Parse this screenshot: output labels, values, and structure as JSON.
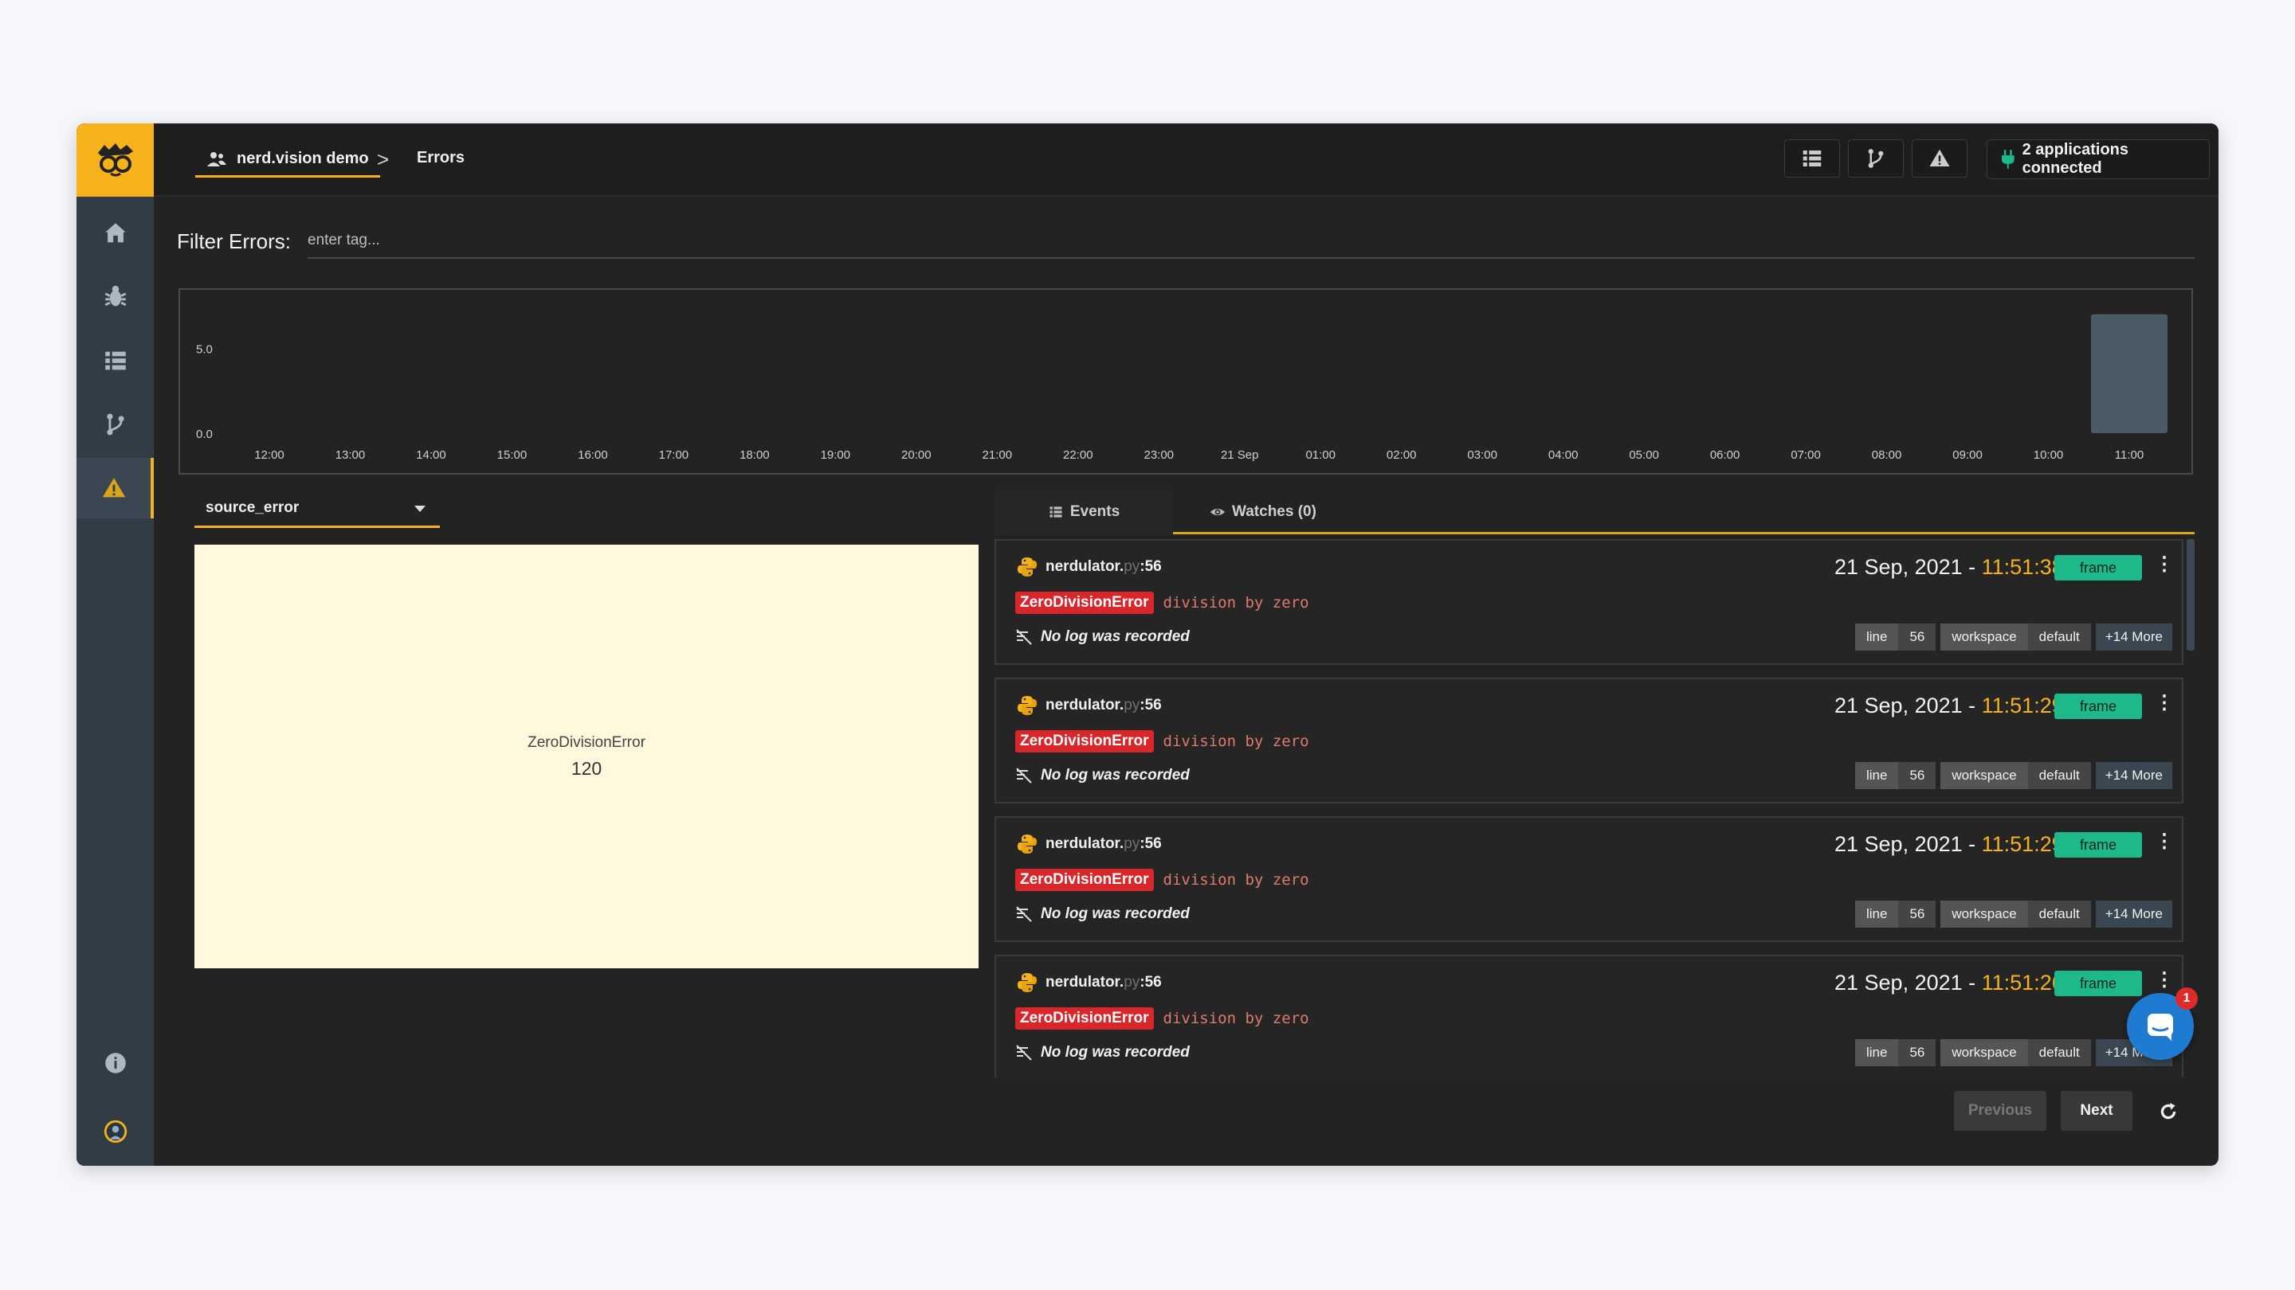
{
  "breadcrumb": {
    "workspace": "nerd.vision demo",
    "separator": ">",
    "current": "Errors"
  },
  "topbar": {
    "apps_connected": "2 applications connected",
    "add": "+"
  },
  "filter": {
    "label": "Filter Errors:",
    "placeholder": "enter tag..."
  },
  "chart_data": {
    "type": "bar",
    "categories": [
      "12:00",
      "13:00",
      "14:00",
      "15:00",
      "16:00",
      "17:00",
      "18:00",
      "19:00",
      "20:00",
      "21:00",
      "22:00",
      "23:00",
      "21 Sep",
      "01:00",
      "02:00",
      "03:00",
      "04:00",
      "05:00",
      "06:00",
      "07:00",
      "08:00",
      "09:00",
      "10:00",
      "11:00"
    ],
    "values": [
      0,
      0,
      0,
      0,
      0,
      0,
      0,
      0,
      0,
      0,
      0,
      0,
      0,
      0,
      0,
      0,
      0,
      0,
      0,
      0,
      0,
      0,
      0,
      7
    ],
    "y_ticks": [
      "5.0",
      "0.0"
    ],
    "ylim": [
      0,
      7.5
    ],
    "grid": false,
    "bar_color": "#4b5b65"
  },
  "tag_select": {
    "value": "source_error"
  },
  "treemap": {
    "name": "ZeroDivisionError",
    "count": "120",
    "color": "#fff8dc"
  },
  "tabs": [
    {
      "label": "Events",
      "icon": "list-icon",
      "active": true
    },
    {
      "label": "Watches (0)",
      "icon": "eye-icon",
      "active": false
    }
  ],
  "events": [
    {
      "file": "nerdulator.",
      "ext": "py",
      "line_ref": ":56",
      "exception": "ZeroDivisionError",
      "message": "division by zero",
      "log": "No log was recorded",
      "date": "21 Sep, 2021 - ",
      "time": "11:51:38",
      "type": "frame",
      "chips": [
        {
          "k": "line",
          "v": "56"
        },
        {
          "k": "workspace",
          "v": "default"
        }
      ],
      "more": "+14 More"
    },
    {
      "file": "nerdulator.",
      "ext": "py",
      "line_ref": ":56",
      "exception": "ZeroDivisionError",
      "message": "division by zero",
      "log": "No log was recorded",
      "date": "21 Sep, 2021 - ",
      "time": "11:51:29",
      "type": "frame",
      "chips": [
        {
          "k": "line",
          "v": "56"
        },
        {
          "k": "workspace",
          "v": "default"
        }
      ],
      "more": "+14 More"
    },
    {
      "file": "nerdulator.",
      "ext": "py",
      "line_ref": ":56",
      "exception": "ZeroDivisionError",
      "message": "division by zero",
      "log": "No log was recorded",
      "date": "21 Sep, 2021 - ",
      "time": "11:51:29",
      "type": "frame",
      "chips": [
        {
          "k": "line",
          "v": "56"
        },
        {
          "k": "workspace",
          "v": "default"
        }
      ],
      "more": "+14 More"
    },
    {
      "file": "nerdulator.",
      "ext": "py",
      "line_ref": ":56",
      "exception": "ZeroDivisionError",
      "message": "division by zero",
      "log": "No log was recorded",
      "date": "21 Sep, 2021 - ",
      "time": "11:51:26",
      "type": "frame",
      "chips": [
        {
          "k": "line",
          "v": "56"
        },
        {
          "k": "workspace",
          "v": "default"
        }
      ],
      "more": "+14 More"
    }
  ],
  "pagination": {
    "previous": "Previous",
    "next": "Next"
  },
  "chat": {
    "unread": "1"
  },
  "colors": {
    "accent": "#f6b21a",
    "frame_badge": "#1db98a",
    "exception_badge": "#d9262b"
  }
}
